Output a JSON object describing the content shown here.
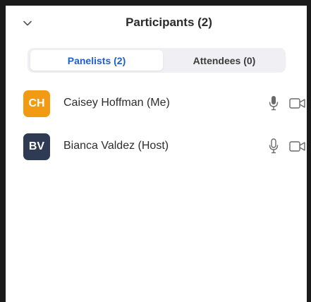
{
  "panel": {
    "title": "Participants (2)",
    "collapse_icon": "chevron-down-icon"
  },
  "tabs": [
    {
      "label": "Panelists (2)",
      "active": true
    },
    {
      "label": "Attendees (0)",
      "active": false
    }
  ],
  "participants": [
    {
      "initials": "CH",
      "name": "Caisey Hoffman (Me)",
      "avatar_color": "#f29b12",
      "mic_state": "active",
      "mic_icon": "microphone-icon",
      "video_icon": "video-camera-icon"
    },
    {
      "initials": "BV",
      "name": "Bianca Valdez (Host)",
      "avatar_color": "#2e3b52",
      "mic_state": "idle",
      "mic_icon": "microphone-icon",
      "video_icon": "video-camera-icon"
    }
  ],
  "colors": {
    "accent": "#1f5fc9",
    "background": "#ffffff",
    "frame": "#1b1b1b"
  }
}
